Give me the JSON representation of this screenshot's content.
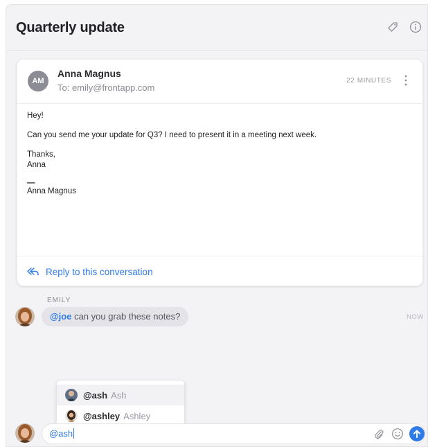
{
  "conversation": {
    "title": "Quarterly update",
    "icons": [
      "tag-icon",
      "info-icon"
    ]
  },
  "message": {
    "avatar_initials": "AM",
    "sender": "Anna Magnus",
    "to_line": "To: emily@frontapp.com",
    "timestamp": "22 MINUTES",
    "body": {
      "greeting": "Hey!",
      "paragraph": "Can you send me your update for Q3? I need to present it in a meeting next week.",
      "thanks": "Thanks,",
      "name": "Anna",
      "dash": "—",
      "signature": "Anna Magnus"
    },
    "reply_label": "Reply to this conversation"
  },
  "comment": {
    "author": "EMILY",
    "mention": "@joe",
    "text": " can you grab these notes?",
    "time": "NOW"
  },
  "mention_dropdown": {
    "options": [
      {
        "handle": "@ash",
        "name": "Ash",
        "selected": true
      },
      {
        "handle": "@ashley",
        "name": "Ashley",
        "selected": false
      }
    ]
  },
  "composer": {
    "value": "@ash"
  },
  "colors": {
    "accent": "#2f7be8",
    "background": "#f3f3f5",
    "bubble": "#e4e4e8"
  }
}
